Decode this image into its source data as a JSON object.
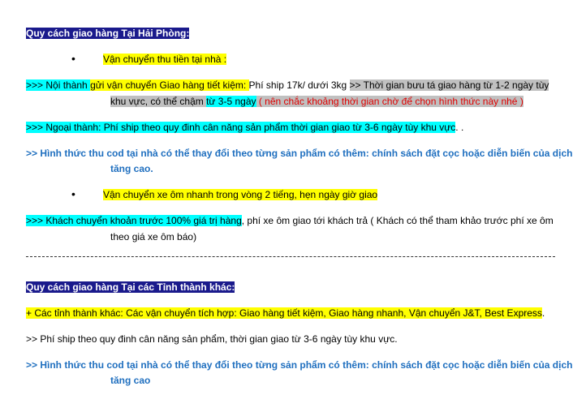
{
  "section1": {
    "title": "Quy cách giao hàng Tại Hải Phòng:",
    "bullet1": "Vận chuyển thu tiền tại nhà :",
    "inner_city": {
      "prefix": ">>> Nội thành ",
      "text1": "gửi vận chuyển Giao hàng tiết kiệm: ",
      "text2": "Phí ship 17k/ dưới 3kg ",
      "text3": ">> Thời gian bưu tá giao hàng từ 1-2 ngày tùy",
      "text4": "khu vực, có thể chậm ",
      "text5": "từ 3-5 ngày",
      "text6": " ( nên chắc khoảng thời gian chờ  để chọn hình thức này nhé )"
    },
    "outer_city": {
      "prefix": ">>> Ngoại thành: ",
      "text": "Phí ship theo quy đinh cân năng sản phẩm thời gian giao từ 3-6  ngày tùy khu vực",
      "suffix": ". ."
    },
    "cod_note": {
      "line1": ">> Hình thức thu cod tại nhà có thể thay đổi theo từng sản phẩm có thêm:  chính sách đặt cọc hoặc diễn biến của dịch",
      "line2": "tăng cao."
    },
    "bullet2": "Vận chuyển xe ôm nhanh trong vòng 2 tiếng, hẹn ngày giờ giao",
    "motorbike": {
      "text1": ">>> Khách chuyển khoản trước 100% giá trị hàng",
      "text2": ", phí xe ôm giao tới khách trả ( Khách có thể tham khảo trước phí xe ôm",
      "line2": "theo giá xe ôm báo)"
    }
  },
  "section2": {
    "title": "Quy cách giao hàng Tại các Tỉnh thành khác:",
    "carriers": "+ Các tỉnh thành khác: Các vận chuyển tích hợp: Giao hàng tiết kiệm, Giao hàng nhanh, Vận chuyển J&T, Best Express",
    "carriers_end": ".",
    "shipping_fee": ">> Phí ship theo quy đinh cân năng sản phẩm, thời gian giao từ 3-6  ngày tùy khu vực.",
    "cod_note": {
      "line1": ">> Hình thức thu cod tại nhà có thể thay đổi theo từng sản phẩm có thêm:  chính sách đặt cọc hoặc diễn biến của dịch",
      "line2": "tăng cao"
    }
  }
}
